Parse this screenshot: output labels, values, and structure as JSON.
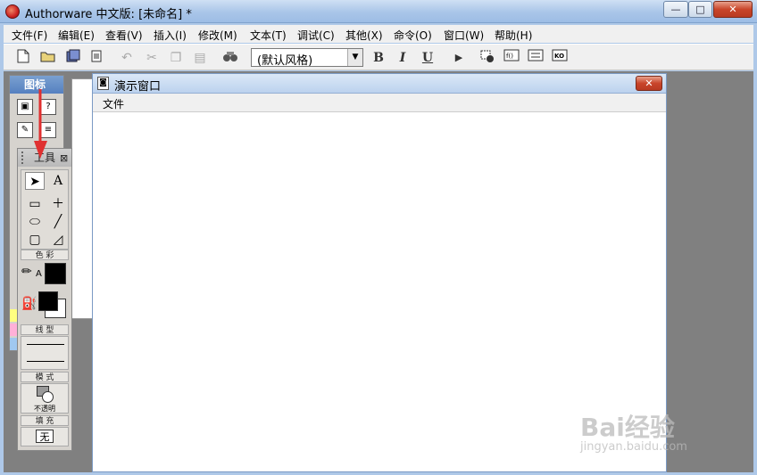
{
  "window": {
    "title": "Authorware 中文版: [未命名] *"
  },
  "caption_buttons": {
    "minimize": "—",
    "maximize": "□",
    "close": "✕"
  },
  "menubar": {
    "items": [
      "文件(F)",
      "编辑(E)",
      "查看(V)",
      "插入(I)",
      "修改(M)",
      "文本(T)",
      "调试(C)",
      "其他(X)",
      "命令(O)",
      "窗口(W)",
      "帮助(H)"
    ]
  },
  "toolbar": {
    "style_select_value": "(默认风格)",
    "bold": "B",
    "italic": "I",
    "underline": "U",
    "icons": [
      "new-file-icon",
      "open-icon",
      "save-all-icon",
      "import-icon",
      "undo-icon",
      "cut-icon",
      "copy-icon",
      "paste-icon",
      "find-icon",
      "style-select",
      "bold-icon",
      "italic-icon",
      "underline-icon",
      "run-icon",
      "control-panel-icon",
      "functions-icon",
      "variables-icon",
      "knowledge-objects-icon"
    ]
  },
  "icon_palette": {
    "title": "图标"
  },
  "tools_palette": {
    "title": "工具",
    "sections": {
      "color": "色 彩",
      "line": "线 型",
      "mode": "模 式",
      "fill": "填 充"
    },
    "mode_label": "不透明",
    "fill_value": "无",
    "text_tool": "A"
  },
  "presentation_window": {
    "title": "演示窗口",
    "menu_file": "文件"
  },
  "watermark": {
    "text": "Bai经验",
    "sub": "jingyan.baidu.com"
  },
  "colors": {
    "titlebar": "#a9c5e8",
    "close_button": "#c9452a",
    "workspace": "#808080",
    "arrow": "#e03030"
  }
}
